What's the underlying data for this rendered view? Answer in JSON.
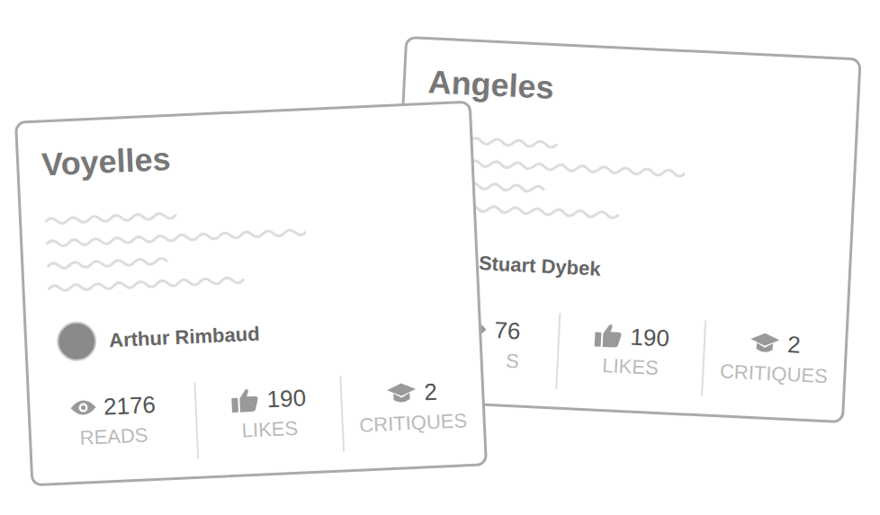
{
  "cards": [
    {
      "title": "Angeles",
      "author": "Stuart Dybek",
      "stats": [
        {
          "kind": "reads",
          "value": "76",
          "label": "S"
        },
        {
          "kind": "likes",
          "value": "190",
          "label": "LIKES"
        },
        {
          "kind": "critiques",
          "value": "2",
          "label": "CRITIQUES"
        }
      ]
    },
    {
      "title": "Voyelles",
      "author": "Arthur Rimbaud",
      "stats": [
        {
          "kind": "reads",
          "value": "2176",
          "label": "READS"
        },
        {
          "kind": "likes",
          "value": "190",
          "label": "LIKES"
        },
        {
          "kind": "critiques",
          "value": "2",
          "label": "CRITIQUES"
        }
      ]
    }
  ]
}
